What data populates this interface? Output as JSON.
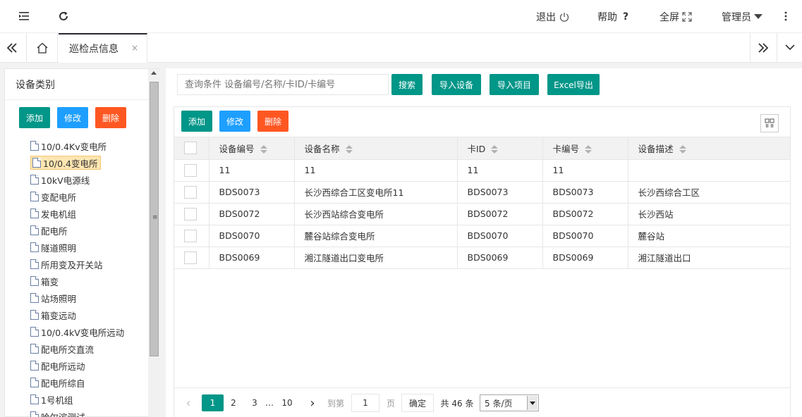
{
  "topbar": {
    "logout": "退出",
    "help": "帮助",
    "help_icon": "?",
    "fullscreen": "全屏",
    "admin": "管理员"
  },
  "tabs": {
    "active_label": "巡检点信息",
    "close_glyph": "×"
  },
  "left_panel": {
    "title": "设备类别",
    "add": "添加",
    "edit": "修改",
    "delete": "删除",
    "items": [
      "10/0.4Kv变电所",
      "10/0.4变电所",
      "10kV电源线",
      "变配电所",
      "发电机组",
      "配电所",
      "隧道照明",
      "所用变及开关站",
      "箱变",
      "站场照明",
      "箱变远动",
      "10/0.4kV变电所远动",
      "配电所交直流",
      "配电所远动",
      "配电所综自",
      "1号机组",
      "哈尔滨测试"
    ],
    "selected_index": 1
  },
  "search": {
    "placeholder": "查询条件 设备编号/名称/卡ID/卡编号",
    "search_btn": "搜索",
    "import_device": "导入设备",
    "import_item": "导入项目",
    "excel_export": "Excel导出"
  },
  "grid": {
    "add": "添加",
    "edit": "修改",
    "delete": "删除",
    "columns": [
      "设备编号",
      "设备名称",
      "卡ID",
      "卡编号",
      "设备描述"
    ],
    "rows": [
      [
        "11",
        "11",
        "11",
        "11",
        ""
      ],
      [
        "BDS0073",
        "长沙西综合工区变电所11",
        "BDS0073",
        "BDS0073",
        "长沙西综合工区"
      ],
      [
        "BDS0072",
        "长沙西站综合变电所",
        "BDS0072",
        "BDS0072",
        "长沙西站"
      ],
      [
        "BDS0070",
        "麓谷站综合变电所",
        "BDS0070",
        "BDS0070",
        "麓谷站"
      ],
      [
        "BDS0069",
        "湘江隧道出口变电所",
        "BDS0069",
        "BDS0069",
        "湘江隧道出口"
      ]
    ]
  },
  "pager": {
    "prev": "‹",
    "pages": [
      "1",
      "2",
      "3",
      "…",
      "10"
    ],
    "next": "›",
    "goto_label": "到第",
    "goto_value": "1",
    "page_unit": "页",
    "confirm": "确定",
    "total": "共 46 条",
    "page_size": "5 条/页"
  },
  "colors": {
    "green": "#009688",
    "blue": "#1e9fff",
    "orange": "#ff5722"
  }
}
